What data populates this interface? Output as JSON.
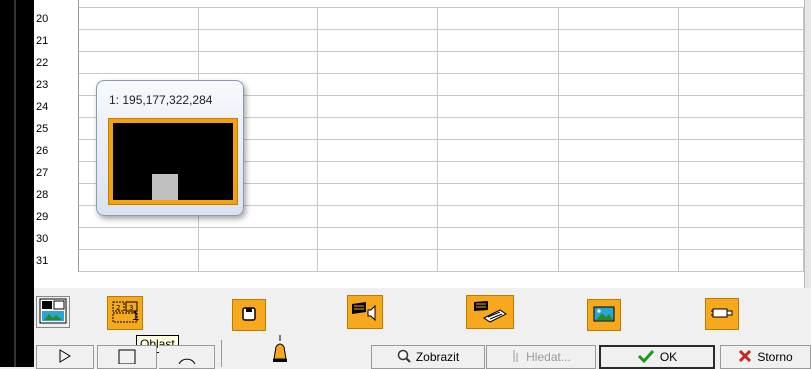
{
  "grid": {
    "row_numbers": [
      "20",
      "21",
      "22",
      "23",
      "24",
      "25",
      "26",
      "27",
      "28",
      "29",
      "30",
      "31"
    ]
  },
  "tooltip_card": {
    "title": "1: 195,177,322,284"
  },
  "toolbar": {
    "region_count": "1",
    "tooltip_text": "Oblast",
    "icons": [
      "image-insert-icon",
      "region-icon",
      "save-icon",
      "sound-icon",
      "keyboard-icon",
      "picture-icon",
      "video-icon",
      "play-icon",
      "rectangle-icon",
      "circle-icon",
      "bell-icon",
      "search-icon",
      "check-icon",
      "cross-icon"
    ]
  },
  "buttons": {
    "show_label": "Zobrazit",
    "find_label": "Hledat...",
    "ok_label": "OK",
    "cancel_label": "Storno"
  },
  "colors": {
    "accent_orange": "#f7a81c",
    "ok_green": "#1a9a1a",
    "cancel_red": "#c8261c"
  }
}
